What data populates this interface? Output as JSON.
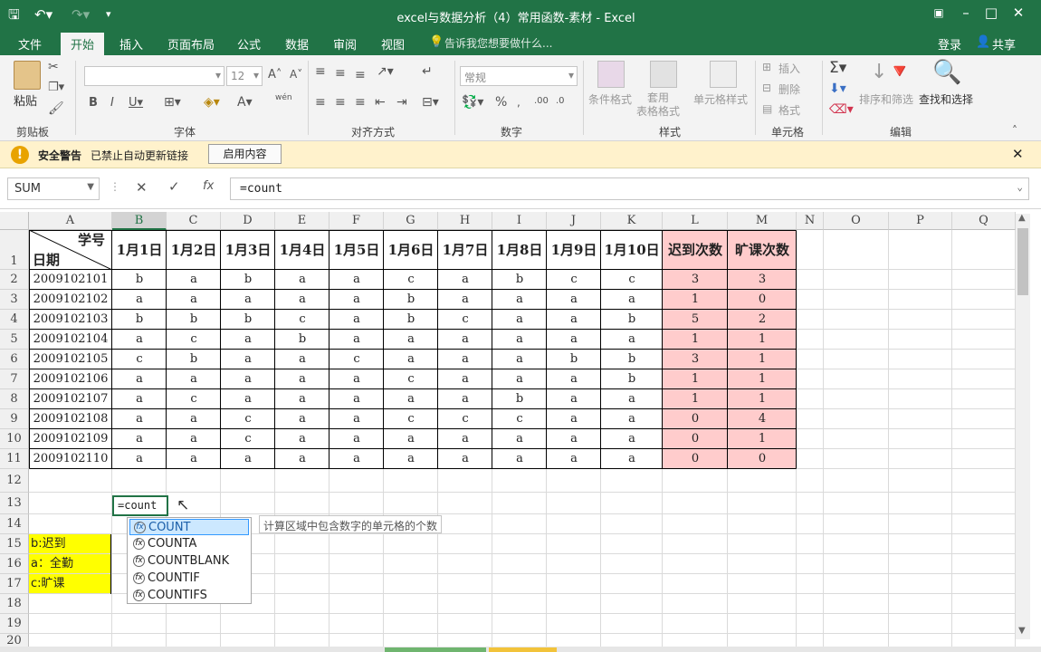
{
  "window": {
    "title": "excel与数据分析（4）常用函数-素材 - Excel"
  },
  "tabs": {
    "file": "文件",
    "home": "开始",
    "insert": "插入",
    "layout": "页面布局",
    "formulas": "公式",
    "data": "数据",
    "review": "审阅",
    "view": "视图",
    "tell": "告诉我您想要做什么...",
    "login": "登录",
    "share": "共享"
  },
  "ribbon": {
    "clipboard": "剪贴板",
    "paste": "粘贴",
    "font_group": "字体",
    "font_size": "12",
    "align_group": "对齐方式",
    "number_group": "数字",
    "number_format": "常规",
    "styles_group": "样式",
    "cond_format": "条件格式",
    "table_format": "套用\n表格格式",
    "cell_style": "单元格样式",
    "cells_group": "单元格",
    "insert": "插入",
    "delete": "删除",
    "format": "格式",
    "edit_group": "编辑",
    "sort_filter": "排序和筛选",
    "find_select": "查找和选择",
    "wen": "wén"
  },
  "warning": {
    "title": "安全警告",
    "text": "已禁止自动更新链接",
    "button": "启用内容"
  },
  "formula": {
    "name_box": "SUM",
    "value": "=count"
  },
  "columns": [
    "A",
    "B",
    "C",
    "D",
    "E",
    "F",
    "G",
    "H",
    "I",
    "J",
    "K",
    "L",
    "M",
    "N",
    "O",
    "P",
    "Q"
  ],
  "rows": [
    "1",
    "2",
    "3",
    "4",
    "5",
    "6",
    "7",
    "8",
    "9",
    "10",
    "11",
    "12",
    "13",
    "14",
    "15",
    "16",
    "17",
    "18",
    "19",
    "20"
  ],
  "header": {
    "corner_top": "学号",
    "corner_bottom": "日期",
    "days": [
      "1月1日",
      "1月2日",
      "1月3日",
      "1月4日",
      "1月5日",
      "1月6日",
      "1月7日",
      "1月8日",
      "1月9日",
      "1月10日"
    ],
    "late": "迟到次数",
    "absent": "旷课次数"
  },
  "table": [
    {
      "id": "2009102101",
      "v": [
        "b",
        "a",
        "b",
        "a",
        "a",
        "c",
        "a",
        "b",
        "c",
        "c"
      ],
      "late": "3",
      "absent": "3"
    },
    {
      "id": "2009102102",
      "v": [
        "a",
        "a",
        "a",
        "a",
        "a",
        "b",
        "a",
        "a",
        "a",
        "a"
      ],
      "late": "1",
      "absent": "0"
    },
    {
      "id": "2009102103",
      "v": [
        "b",
        "b",
        "b",
        "c",
        "a",
        "b",
        "c",
        "a",
        "a",
        "b"
      ],
      "late": "5",
      "absent": "2"
    },
    {
      "id": "2009102104",
      "v": [
        "a",
        "c",
        "a",
        "b",
        "a",
        "a",
        "a",
        "a",
        "a",
        "a"
      ],
      "late": "1",
      "absent": "1"
    },
    {
      "id": "2009102105",
      "v": [
        "c",
        "b",
        "a",
        "a",
        "c",
        "a",
        "a",
        "a",
        "b",
        "b"
      ],
      "late": "3",
      "absent": "1"
    },
    {
      "id": "2009102106",
      "v": [
        "a",
        "a",
        "a",
        "a",
        "a",
        "c",
        "a",
        "a",
        "a",
        "b"
      ],
      "late": "1",
      "absent": "1"
    },
    {
      "id": "2009102107",
      "v": [
        "a",
        "c",
        "a",
        "a",
        "a",
        "a",
        "a",
        "b",
        "a",
        "a"
      ],
      "late": "1",
      "absent": "1"
    },
    {
      "id": "2009102108",
      "v": [
        "a",
        "a",
        "c",
        "a",
        "a",
        "c",
        "c",
        "c",
        "a",
        "a"
      ],
      "late": "0",
      "absent": "4"
    },
    {
      "id": "2009102109",
      "v": [
        "a",
        "a",
        "c",
        "a",
        "a",
        "a",
        "a",
        "a",
        "a",
        "a"
      ],
      "late": "0",
      "absent": "1"
    },
    {
      "id": "2009102110",
      "v": [
        "a",
        "a",
        "a",
        "a",
        "a",
        "a",
        "a",
        "a",
        "a",
        "a"
      ],
      "late": "0",
      "absent": "0"
    }
  ],
  "editing_cell": "=count",
  "legend": [
    "b:迟到",
    "a：全勤",
    "c:旷课"
  ],
  "autocomplete": {
    "items": [
      "COUNT",
      "COUNTA",
      "COUNTBLANK",
      "COUNTIF",
      "COUNTIFS"
    ],
    "tooltip": "计算区域中包含数字的单元格的个数"
  },
  "colors": {
    "brand": "#217346",
    "highlight": "#ffcccc",
    "legend_bg": "#ffff00"
  }
}
